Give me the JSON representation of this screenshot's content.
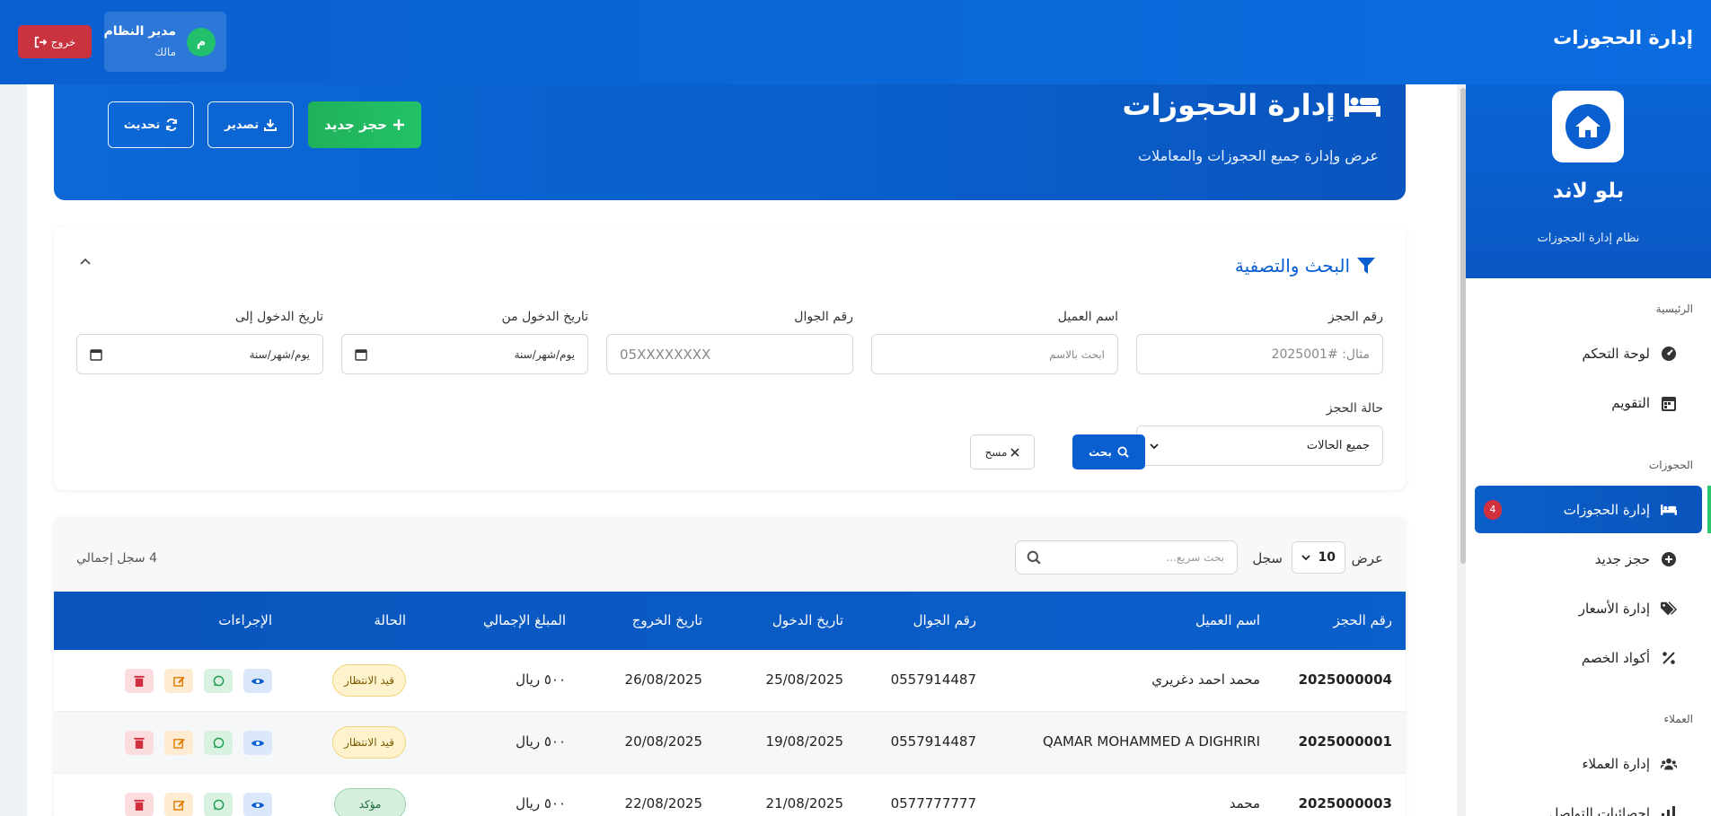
{
  "topbar": {
    "title": "إدارة الحجوزات",
    "user_name": "مدير النظام",
    "user_role": "مالك",
    "avatar_letter": "م",
    "logout_label": "خروج"
  },
  "sidebar": {
    "brand_name": "بلو لاند",
    "brand_subtitle": "نظام إدارة الحجوزات",
    "sections": {
      "home": "الرئيسية",
      "bookings": "الحجوزات",
      "customers": "العملاء"
    },
    "items": [
      {
        "label": "لوحة التحكم",
        "icon": "dashboard-icon"
      },
      {
        "label": "التقويم",
        "icon": "calendar-icon"
      },
      {
        "label": "إدارة الحجوزات",
        "icon": "bed-icon",
        "badge": "4"
      },
      {
        "label": "حجز جديد",
        "icon": "plus-circle-icon"
      },
      {
        "label": "إدارة الأسعار",
        "icon": "tags-icon"
      },
      {
        "label": "أكواد الخصم",
        "icon": "percent-icon"
      },
      {
        "label": "إدارة العملاء",
        "icon": "users-icon"
      },
      {
        "label": "إحصائيات التواصل",
        "icon": "chart-icon"
      }
    ]
  },
  "hero": {
    "title": "إدارة الحجوزات",
    "subtitle": "عرض وإدارة جميع الحجوزات والمعاملات",
    "new_booking_label": "حجز جديد",
    "export_label": "تصدير",
    "refresh_label": "تحديث"
  },
  "filters": {
    "title": "البحث والتصفية",
    "booking_no_label": "رقم الحجز",
    "booking_no_placeholder": "مثال: #2025001",
    "customer_name_label": "اسم العميل",
    "customer_name_placeholder": "ابحث بالاسم",
    "phone_label": "رقم الجوال",
    "phone_placeholder": "05XXXXXXXX",
    "checkin_from_label": "تاريخ الدخول من",
    "checkin_to_label": "تاريخ الدخول إلى",
    "date_placeholder": "يوم/شهر/سنة",
    "status_label": "حالة الحجز",
    "status_value": "جميع الحالات",
    "search_label": "بحث",
    "clear_label": "مسح"
  },
  "table": {
    "show_label": "عرض",
    "page_length": "10",
    "records_label": "سجل",
    "quick_search_placeholder": "بحث سريع...",
    "total_label": "4 سجل إجمالي",
    "columns": [
      "رقم الحجز",
      "اسم العميل",
      "رقم الجوال",
      "تاريخ الدخول",
      "تاريخ الخروج",
      "المبلغ الإجمالي",
      "الحالة",
      "الإجراءات"
    ],
    "rows": [
      {
        "id": "2025000004",
        "name": "محمد احمد دغريري",
        "phone": "0557914487",
        "checkin": "25/08/2025",
        "checkout": "26/08/2025",
        "amount": "٥٠٠ ريال",
        "status": "قيد الانتظار",
        "status_type": "pending"
      },
      {
        "id": "2025000001",
        "name": "QAMAR MOHAMMED A DIGHRIRI",
        "phone": "0557914487",
        "checkin": "19/08/2025",
        "checkout": "20/08/2025",
        "amount": "٥٠٠ ريال",
        "status": "قيد الانتظار",
        "status_type": "pending"
      },
      {
        "id": "2025000003",
        "name": "محمد",
        "phone": "0577777777",
        "checkin": "21/08/2025",
        "checkout": "22/08/2025",
        "amount": "٥٠٠ ريال",
        "status": "مؤكد",
        "status_type": "confirmed"
      }
    ]
  },
  "colors": {
    "primary": "#0a5fd0",
    "success": "#22c06c",
    "danger": "#c9323f",
    "pending_bg": "#fff3cd",
    "confirmed_bg": "#d5eedd"
  }
}
